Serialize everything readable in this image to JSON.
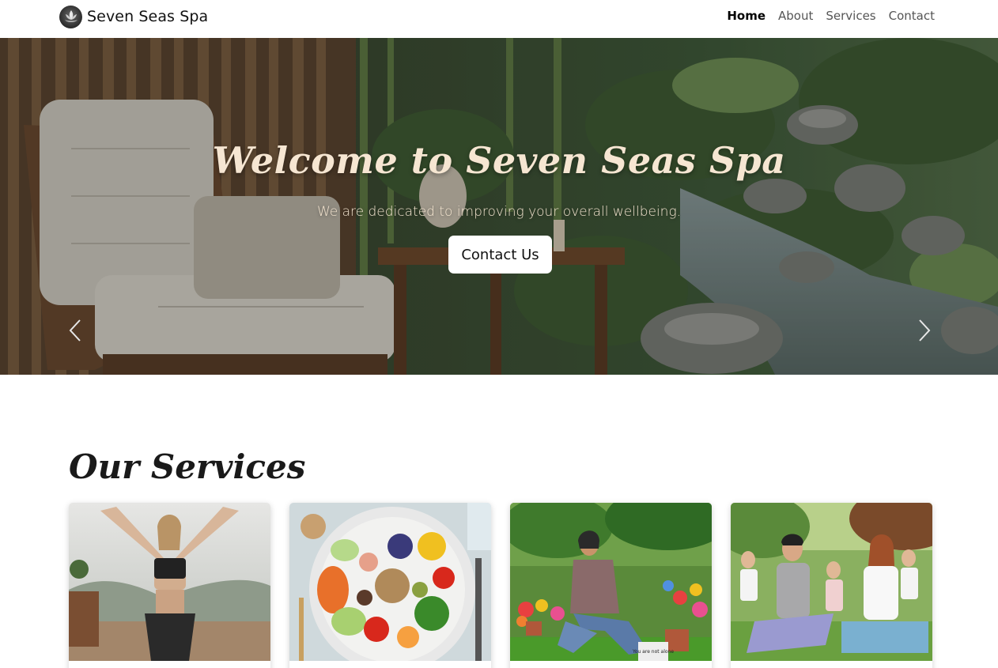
{
  "navbar": {
    "brand": "Seven Seas Spa",
    "logo_icon": "lotus-icon",
    "links": [
      {
        "label": "Home",
        "active": true
      },
      {
        "label": "About",
        "active": false
      },
      {
        "label": "Services",
        "active": false
      },
      {
        "label": "Contact",
        "active": false
      }
    ]
  },
  "hero": {
    "title": "Welcome to Seven Seas Spa",
    "subtitle": "We are dedicated to improving your overall wellbeing.",
    "button_label": "Contact Us",
    "prev_icon": "chevron-left-icon",
    "next_icon": "chevron-right-icon"
  },
  "services": {
    "title": "Our Services",
    "cards": [
      {
        "image": "yoga-woman-photo"
      },
      {
        "image": "healthy-food-plate-photo"
      },
      {
        "image": "relaxing-in-garden-photo",
        "sign_text": "You are not alone"
      },
      {
        "image": "group-meditation-photo"
      }
    ]
  },
  "colors": {
    "hero_text": "#f6e6d2",
    "nav_active": "#000000",
    "nav_link": "#555555"
  }
}
